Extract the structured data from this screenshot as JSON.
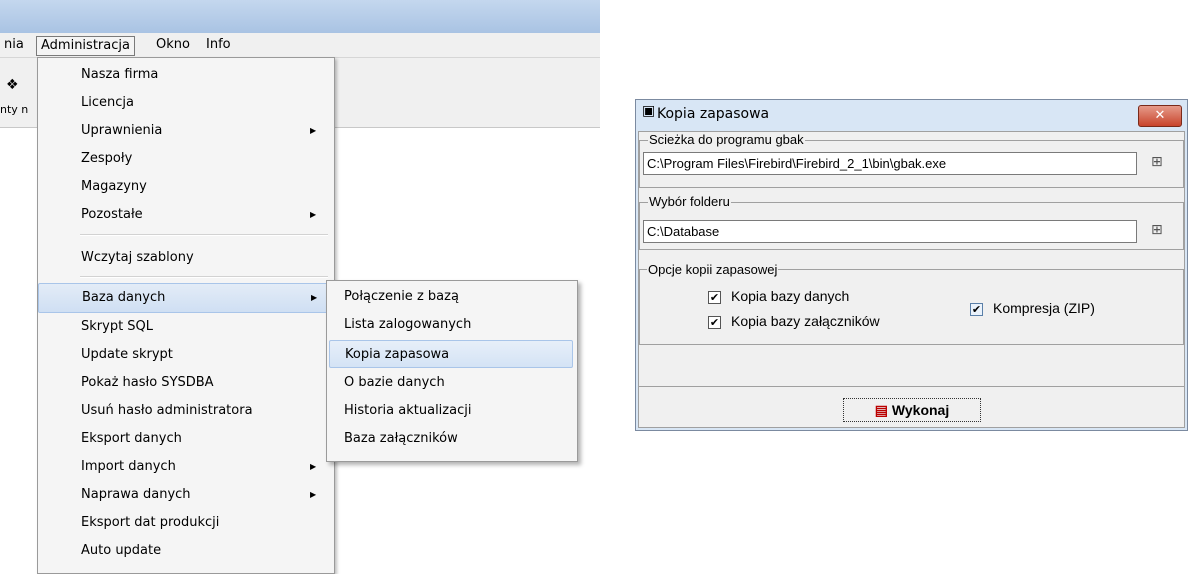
{
  "menubar": {
    "items": [
      "nia",
      "Administracja",
      "Okno",
      "Info"
    ]
  },
  "toolbar": {
    "button_label": "nty n"
  },
  "admin_menu": {
    "items": [
      {
        "label": "Nasza firma",
        "has_submenu": false
      },
      {
        "label": "Licencja",
        "has_submenu": false
      },
      {
        "label": "Uprawnienia",
        "has_submenu": true
      },
      {
        "label": "Zespoły",
        "has_submenu": false
      },
      {
        "label": "Magazyny",
        "has_submenu": false
      },
      {
        "label": "Pozostałe",
        "has_submenu": true
      },
      {
        "label": "Wczytaj szablony",
        "has_submenu": false
      },
      {
        "label": "Baza danych",
        "has_submenu": true,
        "highlighted": true
      },
      {
        "label": "Skrypt SQL",
        "has_submenu": false
      },
      {
        "label": "Update skrypt",
        "has_submenu": false
      },
      {
        "label": "Pokaż hasło SYSDBA",
        "has_submenu": false
      },
      {
        "label": "Usuń hasło administratora",
        "has_submenu": false
      },
      {
        "label": "Eksport danych",
        "has_submenu": false
      },
      {
        "label": "Import danych",
        "has_submenu": true
      },
      {
        "label": "Naprawa danych",
        "has_submenu": true
      },
      {
        "label": "Eksport dat produkcji",
        "has_submenu": false
      },
      {
        "label": "Auto update",
        "has_submenu": false
      }
    ]
  },
  "database_submenu": {
    "items": [
      {
        "label": "Połączenie z bazą"
      },
      {
        "label": "Lista zalogowanych"
      },
      {
        "label": "Kopia zapasowa",
        "highlighted": true
      },
      {
        "label": "O bazie danych"
      },
      {
        "label": "Historia aktualizacji"
      },
      {
        "label": "Baza załączników"
      }
    ]
  },
  "dialog": {
    "title": "Kopia zapasowa",
    "close_label": "✕",
    "gbak_group_label": "Scieżka do programu gbak",
    "gbak_path": "C:\\Program Files\\Firebird\\Firebird_2_1\\bin\\gbak.exe",
    "folder_group_label": "Wybór folderu",
    "folder_path": "C:\\Database",
    "options_group_label": "Opcje kopii zapasowej",
    "options": {
      "db_copy_label": "Kopia bazy danych",
      "db_copy_checked": true,
      "attachments_copy_label": "Kopia bazy załączników",
      "attachments_copy_checked": true,
      "compression_label": "Kompresja  (ZIP)",
      "compression_checked": true
    },
    "run_label": "Wykonaj"
  },
  "colors": {
    "menu_highlight": "#cfdff3",
    "dialog_frame": "#d8e6f5",
    "close_button": "#c8442c"
  }
}
